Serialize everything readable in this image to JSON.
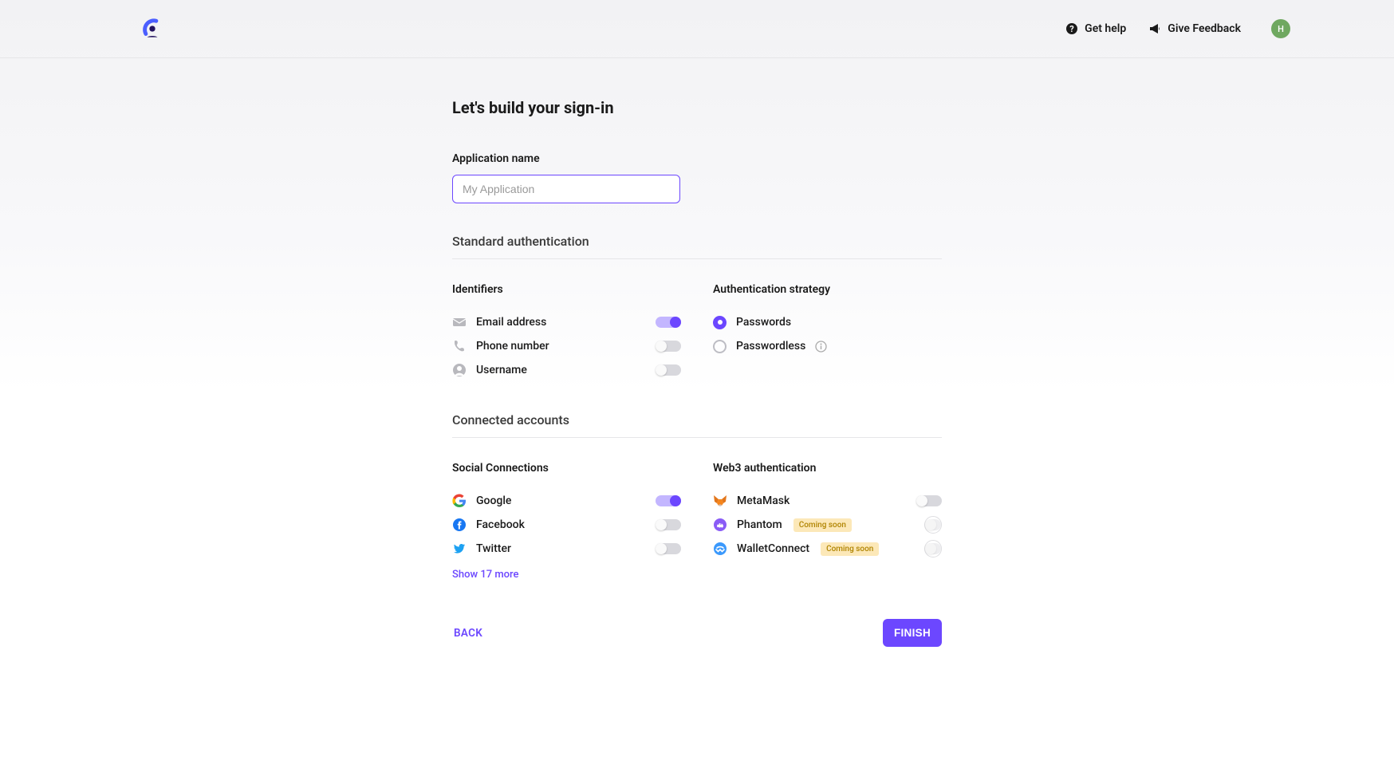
{
  "header": {
    "help_label": "Get help",
    "feedback_label": "Give Feedback",
    "avatar_initial": "H"
  },
  "page": {
    "title": "Let's build your sign-in",
    "app_name_label": "Application name",
    "app_name_placeholder": "My Application"
  },
  "standard": {
    "section_title": "Standard authentication",
    "identifiers_title": "Identifiers",
    "identifiers": [
      {
        "label": "Email address",
        "on": true
      },
      {
        "label": "Phone number",
        "on": false
      },
      {
        "label": "Username",
        "on": false
      }
    ],
    "strategy_title": "Authentication strategy",
    "strategies": [
      {
        "label": "Passwords",
        "selected": true
      },
      {
        "label": "Passwordless",
        "selected": false,
        "info": true
      }
    ]
  },
  "connected": {
    "section_title": "Connected accounts",
    "social_title": "Social Connections",
    "socials": [
      {
        "label": "Google",
        "on": true
      },
      {
        "label": "Facebook",
        "on": false
      },
      {
        "label": "Twitter",
        "on": false
      }
    ],
    "show_more": "Show 17 more",
    "web3_title": "Web3 authentication",
    "web3": [
      {
        "label": "MetaMask",
        "on": false,
        "disabled": false
      },
      {
        "label": "Phantom",
        "on": false,
        "badge": "Coming soon",
        "disabled": true
      },
      {
        "label": "WalletConnect",
        "on": false,
        "badge": "Coming soon",
        "disabled": true
      }
    ]
  },
  "actions": {
    "back": "BACK",
    "finish": "FINISH"
  }
}
